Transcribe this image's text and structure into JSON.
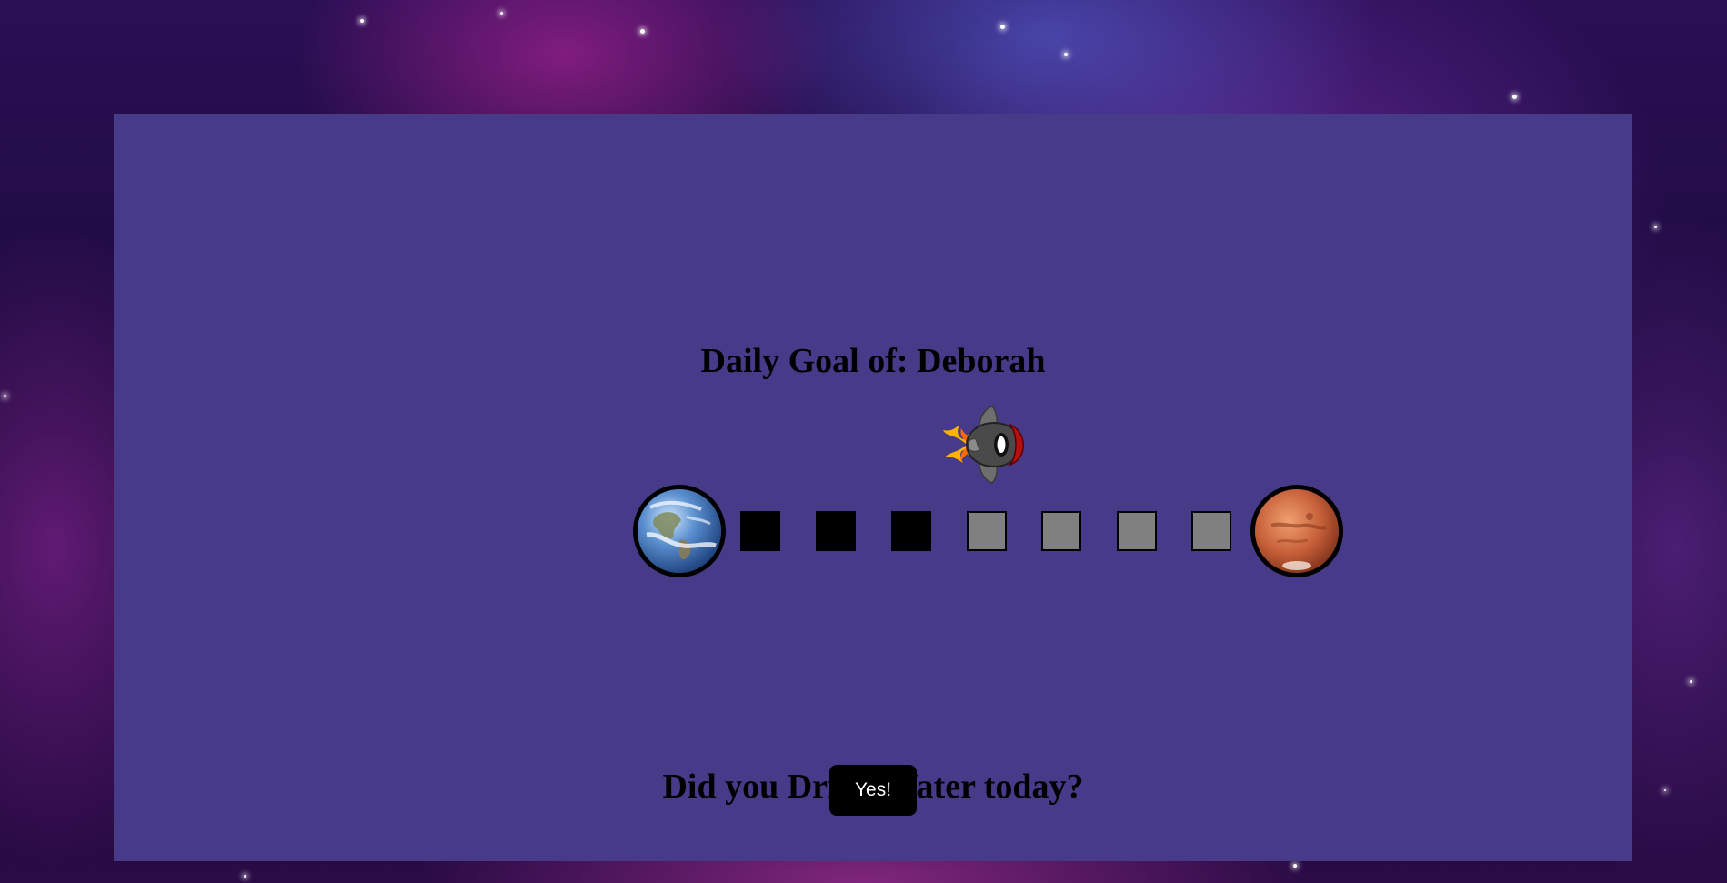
{
  "goal": {
    "title": "Daily Goal of: Deborah"
  },
  "progress": {
    "completed_steps": 3,
    "total_steps": 7,
    "steps": [
      "filled",
      "filled",
      "filled",
      "empty",
      "empty",
      "empty",
      "empty"
    ],
    "start_planet": "earth-icon",
    "end_planet": "mars-icon",
    "marker": "rocket-icon"
  },
  "question": {
    "text": "Did you Drink Water today?"
  },
  "actions": {
    "yes_label": "Yes!"
  },
  "colors": {
    "panel": "#473b89",
    "step_filled": "#000000",
    "step_empty": "#808080",
    "button_bg": "#000000",
    "button_text": "#ffffff"
  }
}
